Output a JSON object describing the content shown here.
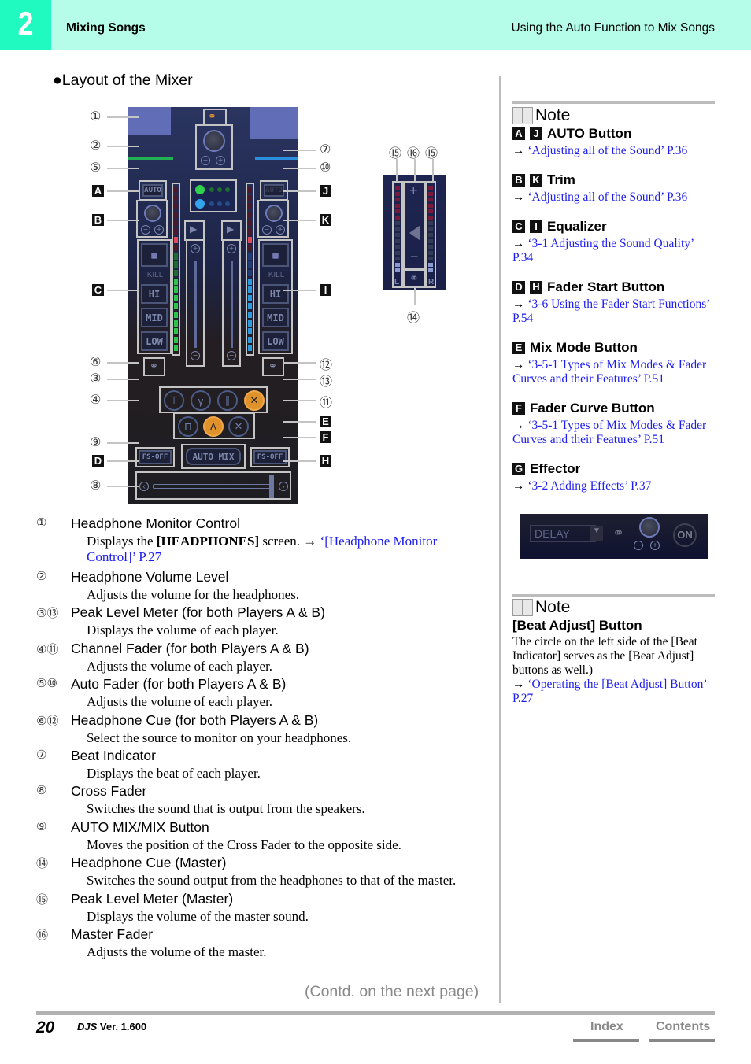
{
  "header": {
    "chapter_number": "2",
    "chapter_title": "Mixing Songs",
    "section_title": "Using the Auto Function to Mix Songs",
    "accent_color": "#20f9c0",
    "band_color": "#b5fde9"
  },
  "section": {
    "bullet": "●",
    "title": "Layout of the Mixer"
  },
  "mixer_image": {
    "callouts_left": [
      "①",
      "②",
      "⑤",
      "A",
      "B",
      "C",
      "⑥",
      "③",
      "④",
      "⑨",
      "D",
      "⑧"
    ],
    "callouts_right": [
      "⑦",
      "⑩",
      "J",
      "K",
      "I",
      "⑫",
      "⑬",
      "⑪",
      "E",
      "F",
      "H"
    ],
    "labels": {
      "auto": "AUTO",
      "kill": "KILL",
      "hi": "HI",
      "mid": "MID",
      "low": "LOW",
      "fs_off": "FS-OFF",
      "auto_mix": "AUTO MIX"
    },
    "meter_colors": {
      "player_a": "#2ec24a",
      "player_b": "#2c9ae0",
      "peak": "#e04a5a"
    }
  },
  "master_image": {
    "callouts_top": [
      "⑮",
      "⑯",
      "⑮"
    ],
    "callout_bottom": "⑭",
    "left_label": "L",
    "right_label": "R"
  },
  "items": [
    {
      "marker": "①",
      "title": "Headphone Monitor Control",
      "desc_pre": "Displays the ",
      "desc_bold": "[HEADPHONES]",
      "desc_post": " screen. → ",
      "link_1": "‘[Headphone Monitor",
      "link_2": "Control]’ P.27"
    },
    {
      "marker": "②",
      "title": "Headphone Volume Level",
      "desc": "Adjusts the volume for the headphones."
    },
    {
      "marker": "③⑬",
      "title": "Peak Level Meter (for both Players A & B)",
      "desc": "Displays the volume of each player."
    },
    {
      "marker": "④⑪",
      "title": "Channel Fader (for both Players A & B)",
      "desc": "Adjusts the volume of each player."
    },
    {
      "marker": "⑤⑩",
      "title": "Auto Fader (for both Players A & B)",
      "desc": "Adjusts the volume of each player."
    },
    {
      "marker": "⑥⑫",
      "title": "Headphone Cue (for both Players A & B)",
      "desc": "Select the source to monitor on your headphones."
    },
    {
      "marker": "⑦",
      "title": "Beat Indicator",
      "desc": "Displays the beat of each player."
    },
    {
      "marker": "⑧",
      "title": "Cross Fader",
      "desc": "Switches the sound that is output from the speakers."
    },
    {
      "marker": "⑨",
      "title": "AUTO MIX/MIX Button",
      "desc": "Moves the position of the Cross Fader to the opposite side."
    },
    {
      "marker": "⑭",
      "title": "Headphone Cue (Master)",
      "desc": "Switches the sound output from the headphones to that of the master."
    },
    {
      "marker": "⑮",
      "title": "Peak Level Meter (Master)",
      "desc": "Displays the volume of the master sound."
    },
    {
      "marker": "⑯",
      "title": "Master Fader",
      "desc": "Adjusts the volume of the master."
    }
  ],
  "notes": {
    "heading": "Note",
    "arrow": "→",
    "entries": [
      {
        "letters": [
          "A",
          "J"
        ],
        "title": "AUTO Button",
        "link": "‘Adjusting all of the Sound’ P.36"
      },
      {
        "letters": [
          "B",
          "K"
        ],
        "title": "Trim",
        "link": "‘Adjusting all of the Sound’ P.36"
      },
      {
        "letters": [
          "C",
          "I"
        ],
        "title": "Equalizer",
        "link": "‘3-1 Adjusting the Sound Quality’ P.34"
      },
      {
        "letters": [
          "D",
          "H"
        ],
        "title": "Fader Start Button",
        "link": "‘3-6 Using the Fader Start Functions’ P.54"
      },
      {
        "letters": [
          "E"
        ],
        "title": "Mix Mode Button",
        "link": "‘3-5-1 Types of Mix Modes & Fader Curves and their Features’ P.51"
      },
      {
        "letters": [
          "F"
        ],
        "title": "Fader Curve Button",
        "link": "‘3-5-1 Types of Mix Modes & Fader Curves and their Features’ P.51"
      },
      {
        "letters": [
          "G"
        ],
        "title": "Effector",
        "link": "‘3-2 Adding Effects’ P.37"
      }
    ],
    "effector_image": {
      "effect_select": "DELAY",
      "on_button": "ON"
    },
    "beat_note": {
      "heading": "Note",
      "title": "[Beat Adjust] Button",
      "body": "The circle on the left side of the [Beat Indicator] serves as the [Beat Adjust] buttons as well.)",
      "link": "‘Operating the [Beat Adjust] Button’ P.27"
    }
  },
  "footer": {
    "contd": "(Contd. on the next page)",
    "page_number": "20",
    "product": "DJS",
    "version": "Ver. 1.600",
    "index_label": "Index",
    "contents_label": "Contents"
  }
}
